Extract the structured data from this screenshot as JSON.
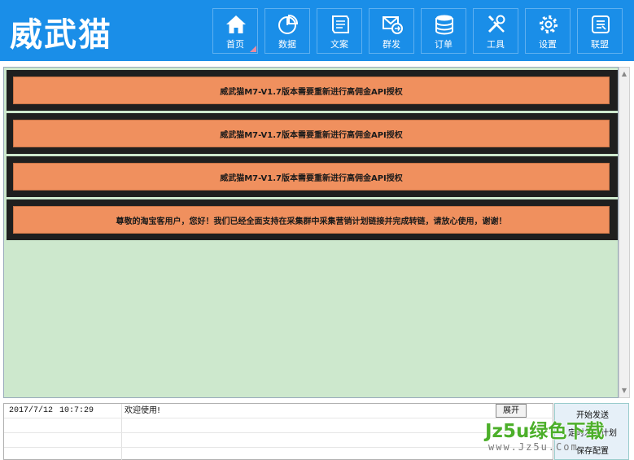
{
  "app": {
    "logo": "威武猫"
  },
  "nav": [
    {
      "label": "首页",
      "icon": "home-icon"
    },
    {
      "label": "数据",
      "icon": "pie-chart-icon"
    },
    {
      "label": "文案",
      "icon": "document-icon"
    },
    {
      "label": "群发",
      "icon": "broadcast-icon"
    },
    {
      "label": "订单",
      "icon": "database-icon"
    },
    {
      "label": "工具",
      "icon": "tools-icon"
    },
    {
      "label": "设置",
      "icon": "gear-icon"
    },
    {
      "label": "联盟",
      "icon": "alliance-icon"
    }
  ],
  "notices": [
    "威武猫M7-V1.7版本需要重新进行高佣金API授权",
    "威武猫M7-V1.7版本需要重新进行高佣金API授权",
    "威武猫M7-V1.7版本需要重新进行高佣金API授权",
    "尊敬的淘宝客用户，您好！我们已经全面支持在采集群中采集营销计划链接并完成转链，请放心使用，谢谢！"
  ],
  "log": {
    "rows": [
      {
        "date": "2017/7/12",
        "time": "10:7:29",
        "message": "欢迎使用!"
      }
    ],
    "expand_label": "展开"
  },
  "side_buttons": [
    {
      "label": "开始发送"
    },
    {
      "label": "定时发送计划"
    },
    {
      "label": "保存配置"
    }
  ],
  "watermark": {
    "main": "Jz5u绿色下载",
    "sub": "www.Jz5u.Com"
  },
  "colors": {
    "header": "#1a8ee8",
    "panel": "#cde8cd",
    "notice": "#f0905e",
    "notice_frame": "#1f1f1f"
  }
}
